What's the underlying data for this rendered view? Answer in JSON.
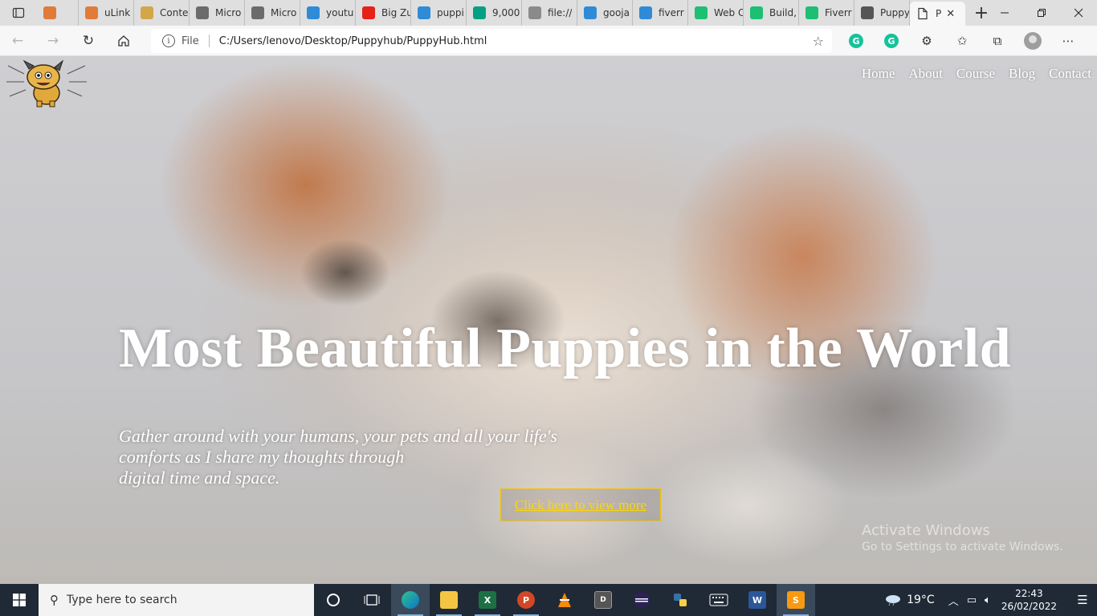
{
  "browser": {
    "tabs": [
      {
        "title": "",
        "icon": "link-icon",
        "color": "#e07b39"
      },
      {
        "title": "uLink",
        "icon": "ulink-icon",
        "color": "#e07b39"
      },
      {
        "title": "Conte",
        "icon": "pencil-icon",
        "color": "#d4a64a"
      },
      {
        "title": "Micro",
        "icon": "blackboard-icon",
        "color": "#6b6b6b"
      },
      {
        "title": "Micro",
        "icon": "blackboard-icon",
        "color": "#6b6b6b"
      },
      {
        "title": "youtu",
        "icon": "bing-icon",
        "color": "#2f8bd6"
      },
      {
        "title": "Big Zu",
        "icon": "youtube-icon",
        "color": "#e62117"
      },
      {
        "title": "puppi",
        "icon": "bing-icon",
        "color": "#2f8bd6"
      },
      {
        "title": "9,000",
        "icon": "pexels-icon",
        "color": "#05a081"
      },
      {
        "title": "file://",
        "icon": "file-icon",
        "color": "#8a8a8a"
      },
      {
        "title": "gooja",
        "icon": "bing-icon",
        "color": "#2f8bd6"
      },
      {
        "title": "fiverr",
        "icon": "bing-icon",
        "color": "#2f8bd6"
      },
      {
        "title": "Web C",
        "icon": "fiverr-icon",
        "color": "#1dbf73"
      },
      {
        "title": "Build,",
        "icon": "fiverr-icon",
        "color": "#1dbf73"
      },
      {
        "title": "Fiverr",
        "icon": "fiverr-icon",
        "color": "#1dbf73"
      },
      {
        "title": "Puppy",
        "icon": "document-icon",
        "color": "#555555"
      }
    ],
    "active_tab": {
      "title": "P",
      "close": "✕"
    },
    "new_tab": "+",
    "address": {
      "scheme": "File",
      "url": "C:/Users/lenovo/Desktop/Puppyhub/PuppyHub.html"
    }
  },
  "page": {
    "nav": [
      "Home",
      "About",
      "Course",
      "Blog",
      "Contact"
    ],
    "hero": {
      "title": "Most Beautiful Puppies in the World",
      "subtitle_lines": [
        "Gather around with your humans, your pets and all your life's",
        "comforts as I share my thoughts through",
        "digital time and space."
      ],
      "cta": "Click here to view more"
    },
    "watermark": {
      "line1": "Activate Windows",
      "line2": "Go to Settings to activate Windows."
    },
    "colors": {
      "cta_border": "#f2c200",
      "cta_text": "#ffd700"
    }
  },
  "taskbar": {
    "search_placeholder": "Type here to search",
    "weather": "19°C",
    "time": "22:43",
    "date": "26/02/2022"
  }
}
